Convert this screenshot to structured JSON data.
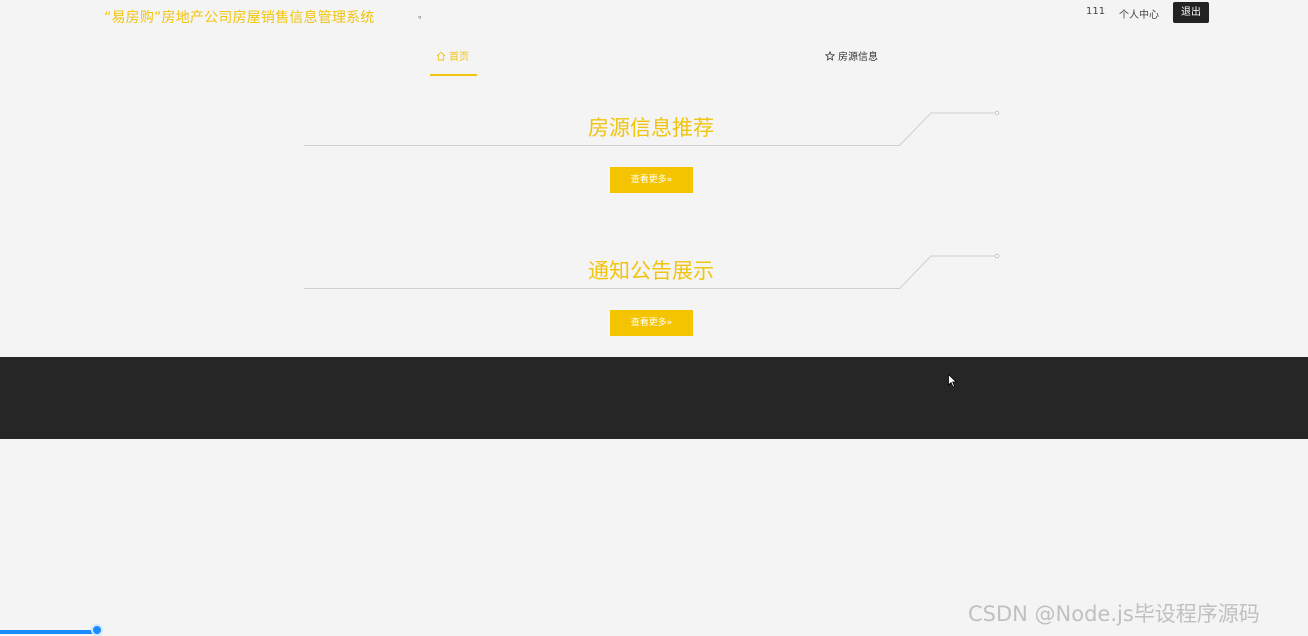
{
  "header": {
    "site_title": "“易房购”房地产公司房屋销售信息管理系统",
    "dot": "。",
    "user_name": "111",
    "user_center": "个人中心",
    "logout": "退出"
  },
  "nav": {
    "items": [
      {
        "label": "首页",
        "icon": "home-icon",
        "active": true
      },
      {
        "label": "房源信息",
        "icon": "star-icon",
        "active": false
      }
    ]
  },
  "sections": [
    {
      "title": "房源信息推荐",
      "more_label": "查看更多»"
    },
    {
      "title": "通知公告展示",
      "more_label": "查看更多»"
    }
  ],
  "watermark": "CSDN @Node.js毕设程序源码",
  "playback": {
    "progress": 0.074
  },
  "colors": {
    "accent": "#f1c40f",
    "button": "#f5c400",
    "footer": "#262626",
    "background": "#f4f4f4",
    "progress": "#1a8cff"
  }
}
